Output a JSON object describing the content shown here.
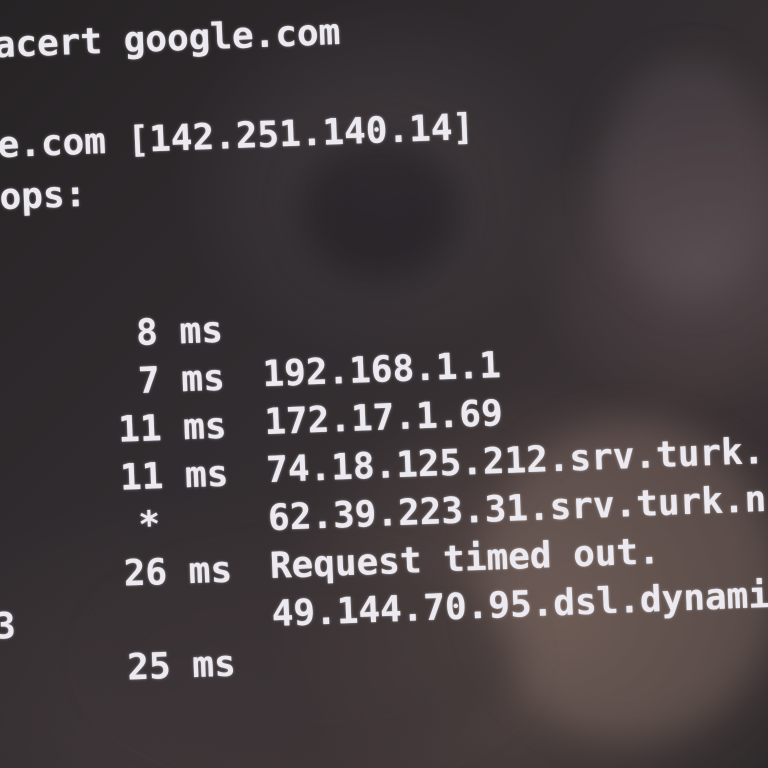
{
  "terminal": {
    "command_line": "acert google.com",
    "route_line": "e.com [142.251.140.14]",
    "hops_line": "ops:",
    "hops": [
      {
        "time": "8 ms",
        "host": "192.168.1.1"
      },
      {
        "time": "7 ms",
        "host": "172.17.1.69"
      },
      {
        "time": "11 ms",
        "host": "74.18.125.212.srv.turk."
      },
      {
        "time": "11 ms",
        "host": "62.39.223.31.srv.turk.n"
      },
      {
        "time": "*",
        "host": "Request timed out."
      },
      {
        "time": "26 ms",
        "host": "49.144.70.95.dsl.dynami"
      },
      {
        "time": "25 ms",
        "host": "",
        "mark": "3"
      }
    ]
  }
}
